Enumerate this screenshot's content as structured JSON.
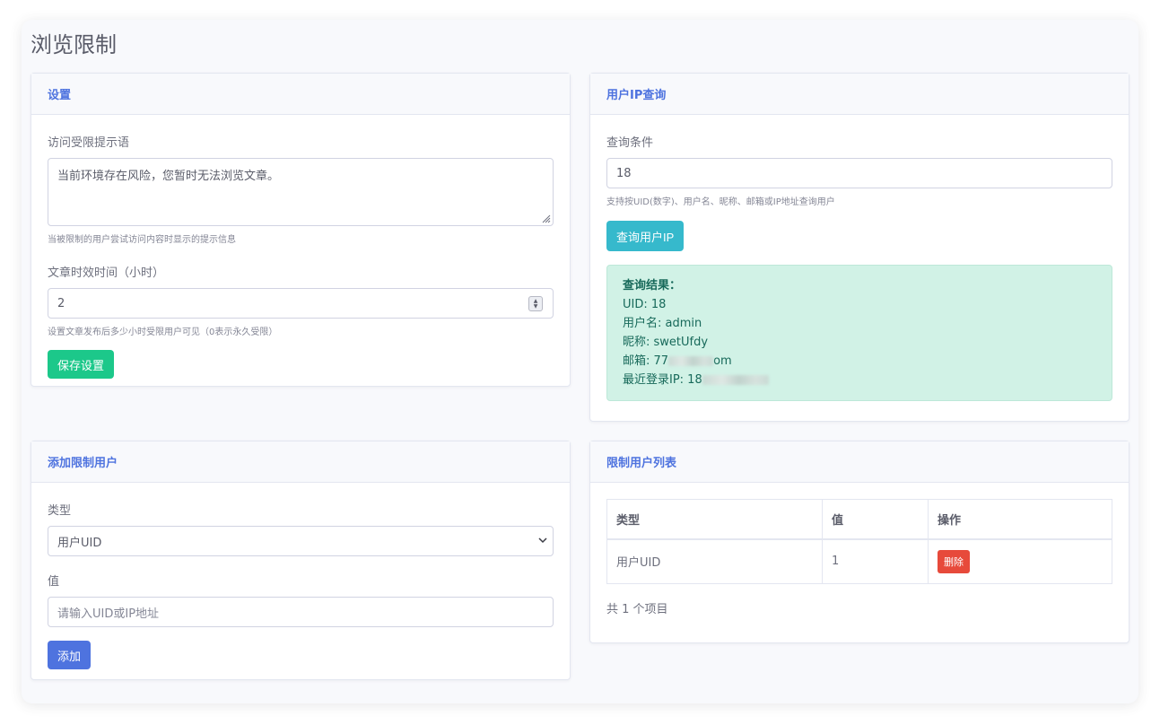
{
  "page": {
    "title": "浏览限制"
  },
  "settings": {
    "header": "设置",
    "message_label": "访问受限提示语",
    "message_value": "当前环境存在风险，您暂时无法浏览文章。",
    "message_help": "当被限制的用户尝试访问内容时显示的提示信息",
    "hours_label": "文章时效时间（小时）",
    "hours_value": "2",
    "hours_help": "设置文章发布后多少小时受限用户可见（0表示永久受限）",
    "save_button": "保存设置"
  },
  "ip_query": {
    "header": "用户IP查询",
    "condition_label": "查询条件",
    "condition_value": "18",
    "condition_help": "支持按UID(数字)、用户名、昵称、邮箱或IP地址查询用户",
    "query_button": "查询用户IP",
    "result": {
      "title": "查询结果：",
      "uid": "UID: 18",
      "username": "用户名: admin",
      "nickname": "昵称: swetUfdy",
      "email_prefix": "邮箱: 77",
      "email_suffix": "om",
      "ip_prefix": "最近登录IP: 18"
    }
  },
  "add_user": {
    "header": "添加限制用户",
    "type_label": "类型",
    "type_selected": "用户UID",
    "value_label": "值",
    "value_placeholder": "请输入UID或IP地址",
    "add_button": "添加"
  },
  "list": {
    "header": "限制用户列表",
    "columns": [
      "类型",
      "值",
      "操作"
    ],
    "rows": [
      {
        "type": "用户UID",
        "value": "1",
        "action": "删除"
      }
    ],
    "total": "共 1 个项目"
  },
  "colors": {
    "accent": "#4e73df",
    "success": "#1cc88a",
    "info": "#36b9cc",
    "danger": "#e74a3b",
    "result_bg": "#d1f2e6"
  }
}
